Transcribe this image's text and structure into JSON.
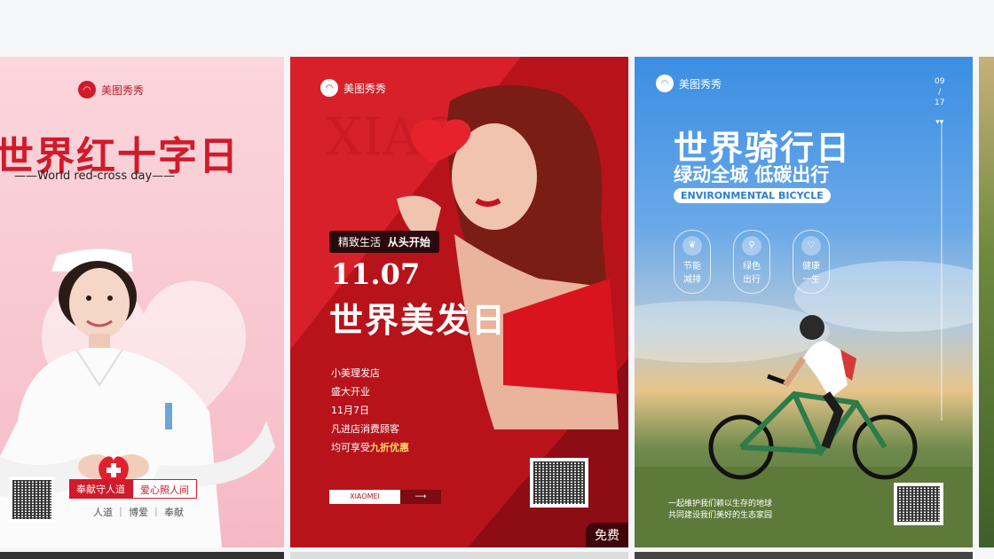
{
  "brand": "美图秀秀",
  "card1": {
    "title": "世界红十字日",
    "subtitle": "——World red-cross day——",
    "tags": [
      "奉献守人道",
      "爱心照人间"
    ],
    "bottom": "人道 ｜ 博爱 ｜ 奉献"
  },
  "card2": {
    "watermark": "XIAO",
    "pill_a": "精致生活",
    "pill_b": "从头开始",
    "date": "11.07",
    "title": "世界美发日",
    "lines": [
      "小美理发店",
      "盛大开业",
      "11月7日",
      "凡进店消费顾客"
    ],
    "last_line_a": "均可享受",
    "last_line_b": "九折优惠",
    "button": "XIAOMEI",
    "badge": "免费"
  },
  "card3": {
    "title": "世界骑行日",
    "subtitle": "绿动全城 低碳出行",
    "english": "ENVIRONMENTAL BICYCLE",
    "date_top": "09",
    "date_sep": "/",
    "date_bottom": "17",
    "features": [
      {
        "icon": "leaf-icon",
        "l1": "节能",
        "l2": "减排"
      },
      {
        "icon": "bike-icon",
        "l1": "绿色",
        "l2": "出行"
      },
      {
        "icon": "heart-icon",
        "l1": "健康",
        "l2": "一生"
      }
    ],
    "foot1": "一起维护我们赖以生存的地球",
    "foot2": "共同建设我们美好的生态家园"
  },
  "colors": {
    "red": "#d11a2a",
    "deep_red": "#b8121b",
    "blue": "#3b8ee3"
  }
}
